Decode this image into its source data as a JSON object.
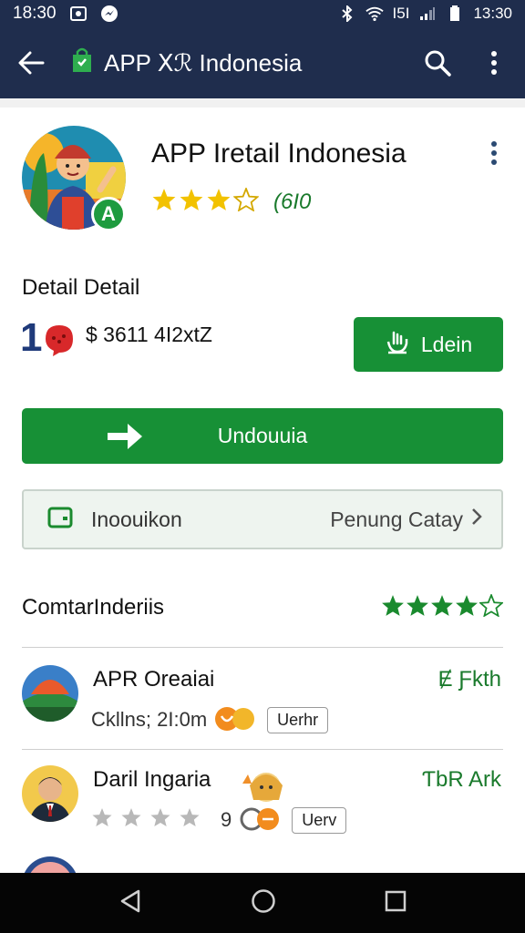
{
  "status_bar": {
    "time_left": "18:30",
    "signal_text": "I5I",
    "time_right": "13:30"
  },
  "app_bar": {
    "title": "APP Ⅹℛ Indonesia"
  },
  "app": {
    "name": "APP Iretail Indonesia",
    "rating_count": "(6I0",
    "stars_filled": 3,
    "stars_total": 4,
    "badge_letter": "A"
  },
  "detail": {
    "heading": "Detail Detail",
    "rank": "1",
    "price": "$ 3611 4I2xtZ",
    "small_button_label": "Ldein"
  },
  "primary_button": {
    "label": "Undouuia"
  },
  "info_box": {
    "label": "Inoouikon",
    "right_text": "Penung Catay"
  },
  "comments": {
    "title": "ComtarInderiis",
    "stars_filled": 4,
    "stars_total": 5
  },
  "reviews": [
    {
      "name": "APR Oreaiai",
      "meta_text": "Ckllns; 2I:0m",
      "tag": "Uerhr",
      "action": "Ɇ Ƒkth"
    },
    {
      "name": "Daril Ingaria",
      "meta_text": "9",
      "tag": "Uerv",
      "action": "ƬbR Ark"
    }
  ],
  "colors": {
    "header_bg": "#1f2d4d",
    "accent_green": "#179036",
    "star_yellow": "#f2c200",
    "star_green": "#1a8a2e"
  }
}
